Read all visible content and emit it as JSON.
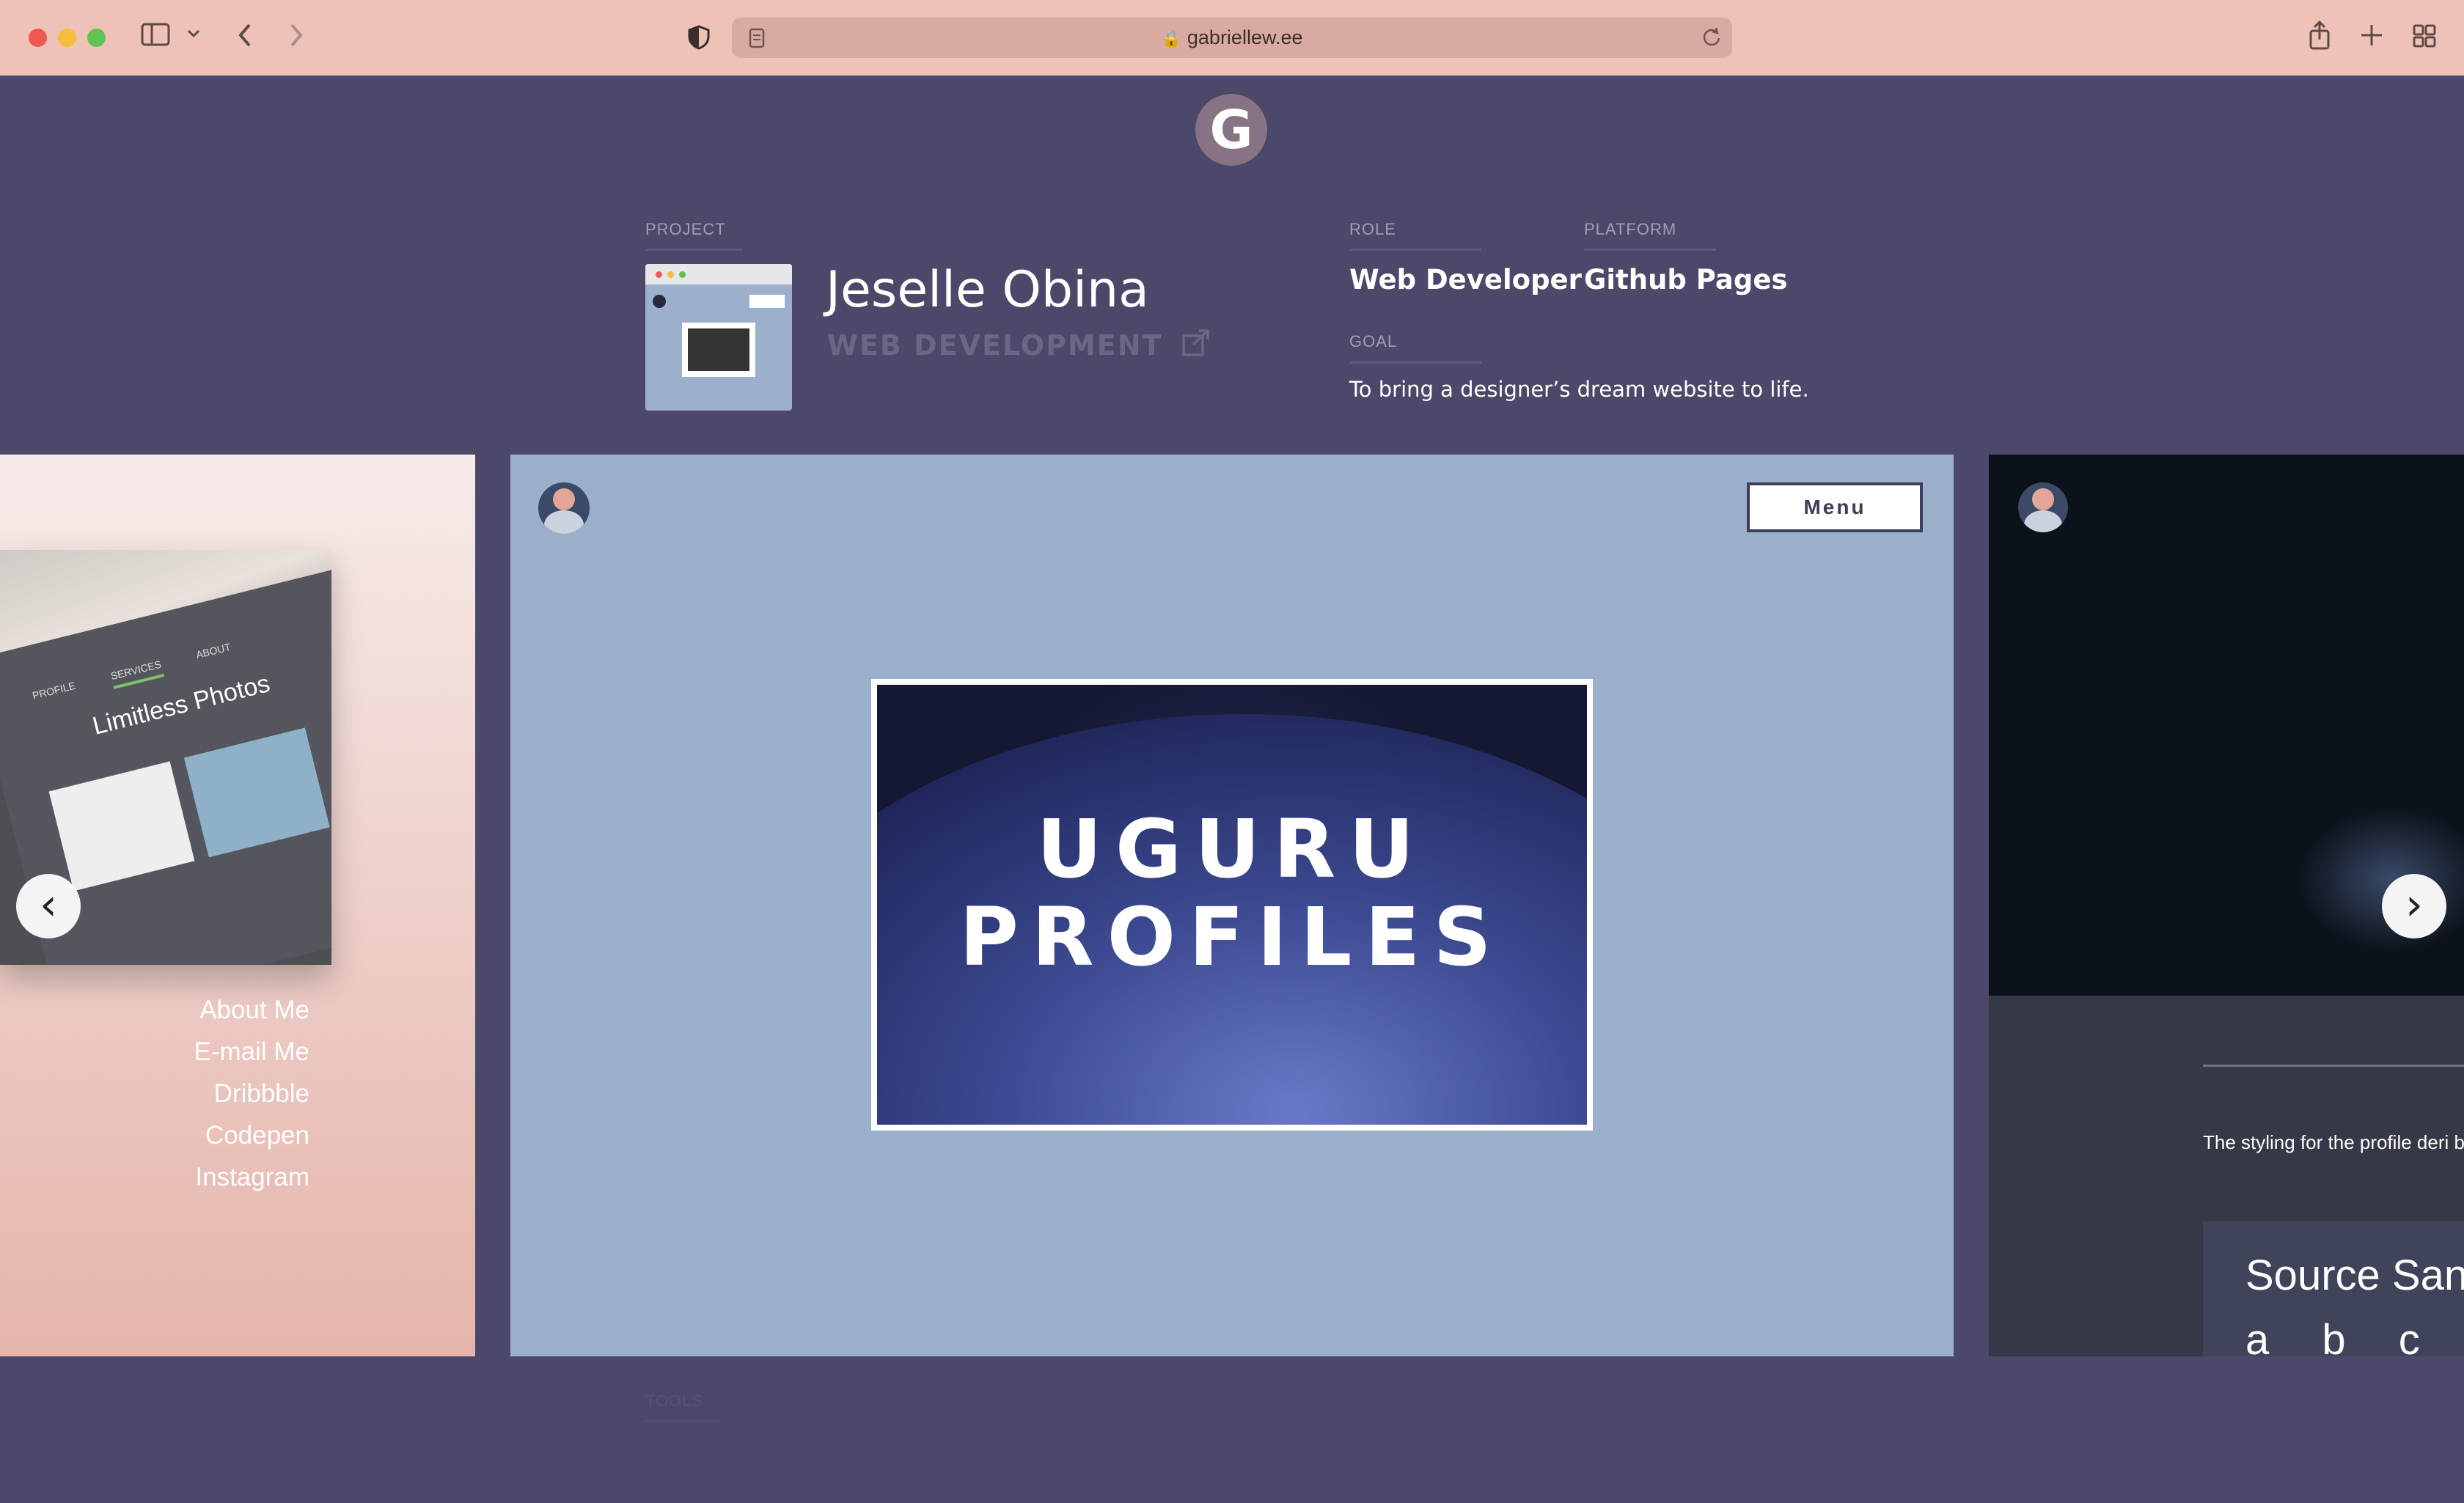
{
  "browser": {
    "url": "gabriellew.ee",
    "icons": {
      "sidebar": "sidebar-icon",
      "back": "back-icon",
      "forward": "forward-icon",
      "shield": "shield-icon",
      "lock": "lock-icon",
      "reload": "reload-icon",
      "share": "share-icon",
      "new_tab": "plus-icon",
      "tabs": "tab-overview-icon"
    }
  },
  "header": {
    "logo": "G",
    "project_label": "PROJECT",
    "project_title": "Jeselle Obina",
    "project_category": "WEB DEVELOPMENT",
    "role_label": "ROLE",
    "role_value": "Web Developer",
    "platform_label": "PLATFORM",
    "platform_value": "Github Pages",
    "goal_label": "GOAL",
    "goal_value": "To bring a designer’s dream website to life."
  },
  "carousel": {
    "left_slide": {
      "mock_site_title": "Limitless Photos",
      "mock_nav": [
        "PROFILE",
        "SERVICES",
        "ABOUT"
      ],
      "links": [
        "About Me",
        "E-mail Me",
        "Dribbble",
        "Codepen",
        "Instagram"
      ]
    },
    "main_slide": {
      "menu_label": "Menu",
      "hero_line1": "UGURU",
      "hero_line2": "PROFILES"
    },
    "right_slide": {
      "text": "The styling for the profile deri brand personality based on p",
      "font_sample_title": "Source Sans",
      "font_sample_letters": "a b c d"
    }
  },
  "footer": {
    "tools_label": "TOOLS"
  },
  "colors": {
    "toolbar": "#efc2b7",
    "page_bg": "#4b4869",
    "main_slide": "#9ab0ca"
  }
}
